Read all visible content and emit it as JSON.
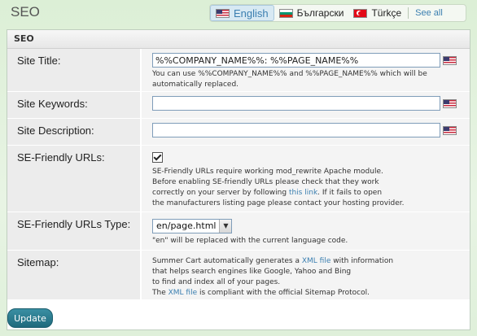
{
  "page": {
    "title": "SEO"
  },
  "languages": {
    "items": [
      {
        "label": "English",
        "flag": "us-flag-icon",
        "active": true
      },
      {
        "label": "Български",
        "flag": "bg-flag-icon",
        "active": false
      },
      {
        "label": "Türkçe",
        "flag": "tr-flag-icon",
        "active": false
      }
    ],
    "see_all": "See all"
  },
  "section": {
    "title": "SEO"
  },
  "fields": {
    "site_title": {
      "label": "Site Title:",
      "value": "%%COMPANY_NAME%%: %%PAGE_NAME%%",
      "help": "You can use %%COMPANY_NAME%% and %%PAGE_NAME%% which will be automatically replaced."
    },
    "site_keywords": {
      "label": "Site Keywords:",
      "value": ""
    },
    "site_description": {
      "label": "Site Description:",
      "value": ""
    },
    "se_friendly": {
      "label": "SE-Friendly URLs:",
      "checked": true,
      "help_1": "SE-Friendly URLs require working mod_rewrite Apache module.",
      "help_2": "Before enabling SE-friendly URLs please check that they work",
      "help_3a": "correctly on your server by following ",
      "help_link": "this link",
      "help_3b": ". If it fails to open",
      "help_4": "the manufacturers listing page please contact your hosting provider."
    },
    "se_type": {
      "label": "SE-Friendly URLs Type:",
      "selected": "en/page.html",
      "help": "\"en\" will be replaced with the current language code."
    },
    "sitemap": {
      "label": "Sitemap:",
      "line1a": "Summer Cart automatically generates a ",
      "link1": "XML file",
      "line1b": " with information",
      "line2": "that helps search engines like Google, Yahoo and Bing",
      "line3": "to find and index all of your pages.",
      "line4a": "The ",
      "link2": "XML file",
      "line4b": " is compliant with the official Sitemap Protocol."
    }
  },
  "actions": {
    "update_label": "Update"
  },
  "colors": {
    "accent": "#3b7fb0",
    "button": "#2a7d90"
  }
}
